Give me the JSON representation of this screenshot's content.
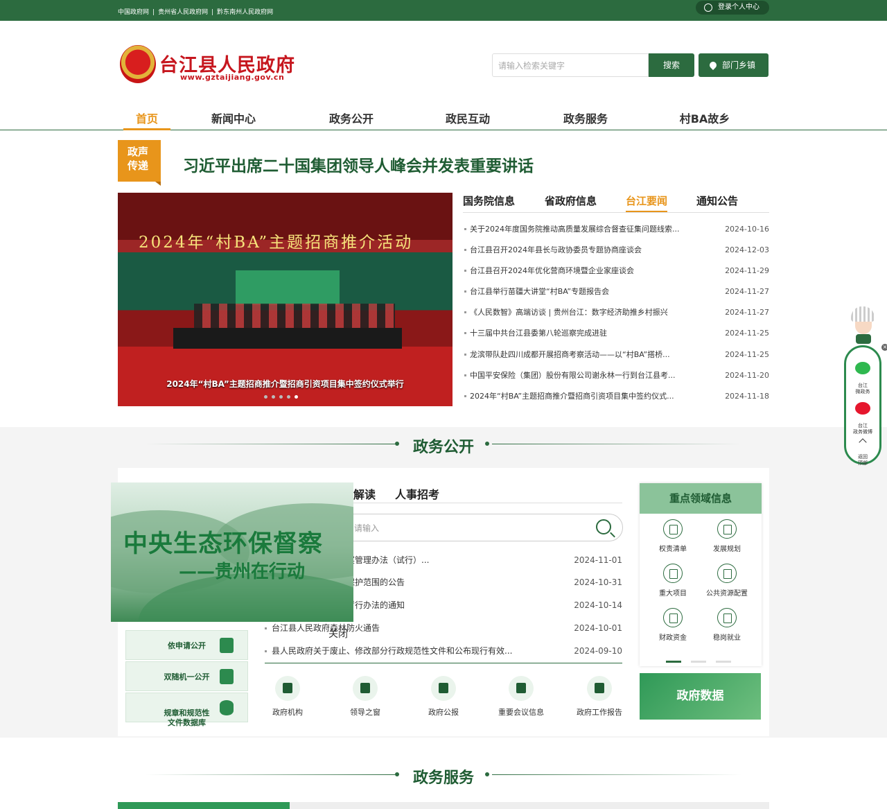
{
  "topbar": {
    "links": [
      "中国政府网",
      "贵州省人民政府网",
      "黔东南州人民政府网"
    ],
    "login": "登录个人中心"
  },
  "header": {
    "site_title": "台江县人民政府",
    "site_url": "www.gztaijiang.gov.cn",
    "search_placeholder": "请输入检索关键字",
    "search_button": "搜索",
    "dept_button": "部门乡镇"
  },
  "nav": [
    "首页",
    "新闻中心",
    "政务公开",
    "政民互动",
    "政务服务",
    "村BA故乡"
  ],
  "banner": {
    "tag_line1": "政声",
    "tag_line2": "传递",
    "headline": "习近平出席二十国集团领导人峰会并发表重要讲话"
  },
  "slider": {
    "banner_text": "2024年“村BA”主题招商推介活动",
    "caption": "2024年“村BA”主题招商推介暨招商引资项目集中签约仪式举行",
    "dot_count": 5,
    "active_dot": 5
  },
  "news": {
    "tabs": [
      "国务院信息",
      "省政府信息",
      "台江要闻",
      "通知公告"
    ],
    "active_tab": "台江要闻",
    "items": [
      {
        "title": "关于2024年度国务院推动高质量发展综合督查征集问题线索...",
        "date": "2024-10-16"
      },
      {
        "title": "台江县召开2024年县长与政协委员专题协商座谈会",
        "date": "2024-12-03"
      },
      {
        "title": "台江县召开2024年优化营商环境暨企业家座谈会",
        "date": "2024-11-29"
      },
      {
        "title": "台江县举行苗疆大讲堂“村BA”专题报告会",
        "date": "2024-11-27"
      },
      {
        "title": "《人民数智》高端访谈 | 贵州台江：数字经济助推乡村振兴",
        "date": "2024-11-27"
      },
      {
        "title": "十三届中共台江县委第八轮巡察完成进驻",
        "date": "2024-11-25"
      },
      {
        "title": "龙滨带队赴四川成都开展招商考察活动——以“村BA”搭桥...",
        "date": "2024-11-25"
      },
      {
        "title": "中国平安保险（集团）股份有限公司谢永林一行到台江县考...",
        "date": "2024-11-20"
      },
      {
        "title": "2024年“村BA”主题招商推介暨招商引资项目集中签约仪式...",
        "date": "2024-11-18"
      }
    ]
  },
  "zwgk": {
    "title": "政务公开",
    "tabs": [
      "解读",
      "人事招考"
    ],
    "search_placeholder": "请输入",
    "items": [
      {
        "title": "印发台江县县长质量奖管理办法（试行）...",
        "date": "2024-11-01"
      },
      {
        "title": "划定台江县烈士陵园保护范围的公告",
        "date": "2024-10-31"
      },
      {
        "title": "印发台江县城市管理暂行办法的通知",
        "date": "2024-10-14"
      },
      {
        "title": "台江县人民政府森林防火通告",
        "date": "2024-10-01"
      },
      {
        "title": "县人民政府关于废止、修改部分行政规范性文件和公布现行有效...",
        "date": "2024-09-10"
      }
    ],
    "left_buttons": [
      "依申请公开",
      "双随机一公开",
      "规章和规范性\n文件数据库"
    ],
    "quick_links": [
      "政府机构",
      "领导之窗",
      "政府公报",
      "重要会议信息",
      "政府工作报告"
    ],
    "focus_title": "重点领域信息",
    "focus_items": [
      "权责清单",
      "发展规划",
      "重大项目",
      "公共资源配置",
      "财政资金",
      "稳岗就业"
    ],
    "gov_data": "政府数据"
  },
  "popup": {
    "line1": "中央生态环保督察",
    "line2": "——贵州在行动",
    "close": "关闭"
  },
  "float_widget": {
    "items": [
      "台江\n微政务",
      "台江\n政务微博",
      "返回\n顶部"
    ],
    "close": "×"
  },
  "zwfw": {
    "title": "政务服务"
  },
  "colors": {
    "primary": "#2c6b3f",
    "accent": "#e8951b",
    "brand_red": "#c6161e"
  }
}
